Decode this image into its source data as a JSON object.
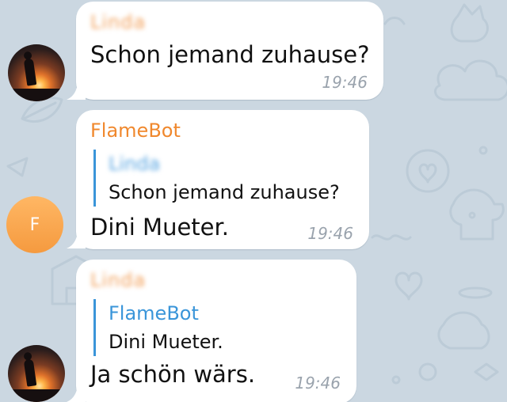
{
  "chat": {
    "messages": [
      {
        "sender": "Linda",
        "text": "Schon jemand zuhause?",
        "time": "19:46",
        "avatar_icon": "sunset-photo-avatar"
      },
      {
        "sender": "FlameBot",
        "reply_to": {
          "sender": "Linda",
          "text": "Schon jemand zuhause?"
        },
        "text": "Dini Mueter.",
        "time": "19:46",
        "avatar_letter": "F",
        "avatar_color": "#f7a44f"
      },
      {
        "sender": "Linda",
        "reply_to": {
          "sender": "FlameBot",
          "text": "Dini Mueter."
        },
        "text": "Ja schön wärs.",
        "time": "19:46",
        "avatar_icon": "sunset-photo-avatar"
      }
    ]
  },
  "colors": {
    "wallpaper": "#cbd7e1",
    "bubble": "#ffffff",
    "sender_name": "#f0882d",
    "reply_accent": "#3a95d9",
    "timestamp": "#9aa3ad"
  }
}
